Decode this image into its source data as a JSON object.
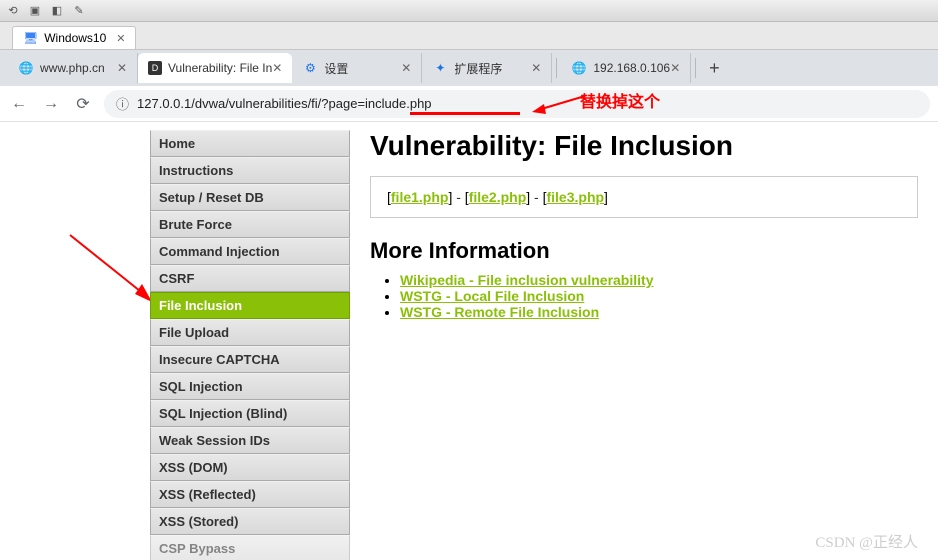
{
  "window_tab": {
    "title": "Windows10"
  },
  "browser_tabs": [
    {
      "label": "www.php.cn",
      "favicon": "globe"
    },
    {
      "label": "Vulnerability: File In",
      "favicon": "dvwa",
      "active": true
    },
    {
      "label": "设置",
      "favicon": "gear"
    },
    {
      "label": "扩展程序",
      "favicon": "puzzle"
    },
    {
      "label": "192.168.0.106",
      "favicon": "globe"
    }
  ],
  "url": "127.0.0.1/dvwa/vulnerabilities/fi/?page=include.php",
  "annotation": "替换掉这个",
  "sidebar": {
    "group1": [
      {
        "label": "Home"
      },
      {
        "label": "Instructions"
      },
      {
        "label": "Setup / Reset DB"
      }
    ],
    "group2": [
      {
        "label": "Brute Force"
      },
      {
        "label": "Command Injection"
      },
      {
        "label": "CSRF"
      },
      {
        "label": "File Inclusion",
        "active": true
      },
      {
        "label": "File Upload"
      },
      {
        "label": "Insecure CAPTCHA"
      },
      {
        "label": "SQL Injection"
      },
      {
        "label": "SQL Injection (Blind)"
      },
      {
        "label": "Weak Session IDs"
      },
      {
        "label": "XSS (DOM)"
      },
      {
        "label": "XSS (Reflected)"
      },
      {
        "label": "XSS (Stored)"
      },
      {
        "label": "CSP Bypass"
      }
    ]
  },
  "main": {
    "title": "Vulnerability: File Inclusion",
    "files": [
      "file1.php",
      "file2.php",
      "file3.php"
    ],
    "more_info_heading": "More Information",
    "links": [
      "Wikipedia - File inclusion vulnerability",
      "WSTG - Local File Inclusion",
      "WSTG - Remote File Inclusion"
    ]
  },
  "watermark": "CSDN @正经人"
}
